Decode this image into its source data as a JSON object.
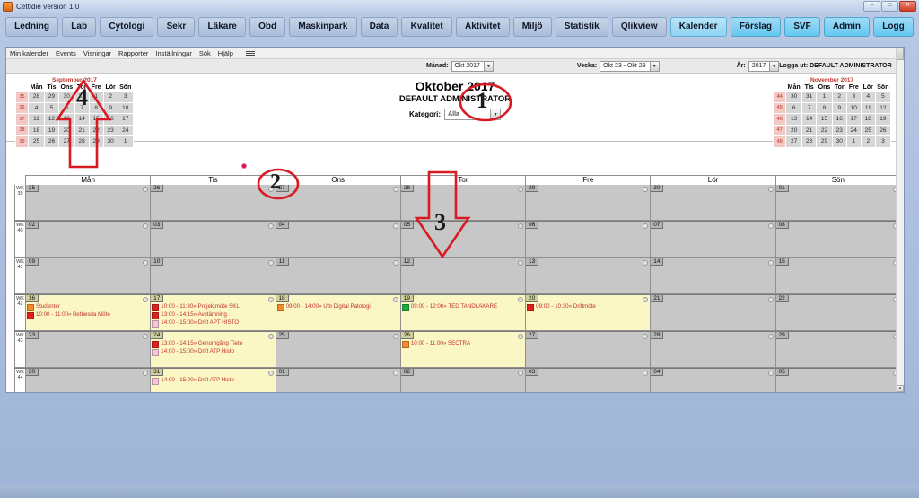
{
  "window": {
    "title": "Cettidie version 1.0",
    "min_label": "–",
    "max_label": "□",
    "close_label": "✕"
  },
  "nav": {
    "buttons": [
      {
        "label": "Ledning",
        "state": "normal"
      },
      {
        "label": "Lab",
        "state": "normal"
      },
      {
        "label": "Cytologi",
        "state": "normal"
      },
      {
        "label": "Sekr",
        "state": "normal"
      },
      {
        "label": "Läkare",
        "state": "normal"
      },
      {
        "label": "Obd",
        "state": "normal"
      },
      {
        "label": "Maskinpark",
        "state": "normal"
      },
      {
        "label": "Data",
        "state": "normal"
      },
      {
        "label": "Kvalitet",
        "state": "normal"
      },
      {
        "label": "Aktivitet",
        "state": "normal"
      },
      {
        "label": "Miljö",
        "state": "normal"
      },
      {
        "label": "Statistik",
        "state": "normal"
      },
      {
        "label": "Qlikview",
        "state": "normal"
      },
      {
        "label": "Kalender",
        "state": "selected"
      },
      {
        "label": "Förslag",
        "state": "highlight"
      },
      {
        "label": "SVF",
        "state": "highlight"
      },
      {
        "label": "Admin",
        "state": "highlight"
      },
      {
        "label": "Logg",
        "state": "highlight"
      }
    ]
  },
  "menu": {
    "items": [
      "Min kalender",
      "Events",
      "Visningar",
      "Rapporter",
      "Inställningar",
      "Sök",
      "Hjälp"
    ],
    "grip_icon": "menu-grip-icon"
  },
  "toolbar": {
    "month": {
      "label": "Månad:",
      "value": "Okt 2017",
      "arrow": "▼"
    },
    "week": {
      "label": "Vecka:",
      "value": "Okt 23 - Okt 29",
      "arrow": "▼"
    },
    "year": {
      "label": "År:",
      "value": "2017",
      "arrow": "▼"
    },
    "logout": "Logga ut: DEFAULT ADMINISTRATOR"
  },
  "header": {
    "month_title": "Oktober 2017",
    "user": "DEFAULT ADMINISTRATOR",
    "category_label": "Kategori:",
    "category_value": "Alla",
    "category_arrow": "▼"
  },
  "mini_prev": {
    "caption": "September 2017",
    "weekday_headers": [
      "Mån",
      "Tis",
      "Ons",
      "Tor",
      "Fre",
      "Lör",
      "Sön"
    ],
    "rows": [
      {
        "wk": "35",
        "days": [
          "28",
          "29",
          "30",
          "31",
          "1",
          "2",
          "3"
        ]
      },
      {
        "wk": "36",
        "days": [
          "4",
          "5",
          "6",
          "7",
          "8",
          "9",
          "10"
        ]
      },
      {
        "wk": "37",
        "days": [
          "11",
          "12",
          "13",
          "14",
          "15",
          "16",
          "17"
        ]
      },
      {
        "wk": "38",
        "days": [
          "18",
          "19",
          "20",
          "21",
          "22",
          "23",
          "24"
        ]
      },
      {
        "wk": "39",
        "days": [
          "25",
          "26",
          "27",
          "28",
          "29",
          "30",
          "1"
        ]
      }
    ]
  },
  "mini_next": {
    "caption": "November 2017",
    "weekday_headers": [
      "Mån",
      "Tis",
      "Ons",
      "Tor",
      "Fre",
      "Lör",
      "Sön"
    ],
    "rows": [
      {
        "wk": "44",
        "days": [
          "30",
          "31",
          "1",
          "2",
          "3",
          "4",
          "5"
        ]
      },
      {
        "wk": "45",
        "days": [
          "6",
          "7",
          "8",
          "9",
          "10",
          "11",
          "12"
        ]
      },
      {
        "wk": "46",
        "days": [
          "13",
          "14",
          "15",
          "16",
          "17",
          "18",
          "19"
        ]
      },
      {
        "wk": "47",
        "days": [
          "20",
          "21",
          "22",
          "23",
          "24",
          "25",
          "26"
        ]
      },
      {
        "wk": "48",
        "days": [
          "27",
          "28",
          "29",
          "30",
          "1",
          "2",
          "3"
        ]
      }
    ]
  },
  "calendar": {
    "day_headers": [
      "Mån",
      "Tis",
      "Ons",
      "Tor",
      "Fre",
      "Lör",
      "Sön"
    ],
    "weeks": [
      {
        "wk": "WK39",
        "days": [
          {
            "num": "25",
            "events": []
          },
          {
            "num": "26",
            "events": []
          },
          {
            "num": "27",
            "events": []
          },
          {
            "num": "28",
            "events": []
          },
          {
            "num": "29",
            "events": []
          },
          {
            "num": "30",
            "events": []
          },
          {
            "num": "01",
            "events": []
          }
        ]
      },
      {
        "wk": "WK40",
        "days": [
          {
            "num": "02",
            "events": []
          },
          {
            "num": "03",
            "events": []
          },
          {
            "num": "04",
            "events": []
          },
          {
            "num": "05",
            "events": []
          },
          {
            "num": "06",
            "events": []
          },
          {
            "num": "07",
            "events": []
          },
          {
            "num": "08",
            "events": []
          }
        ]
      },
      {
        "wk": "WK41",
        "days": [
          {
            "num": "09",
            "events": []
          },
          {
            "num": "10",
            "events": []
          },
          {
            "num": "11",
            "events": []
          },
          {
            "num": "12",
            "events": []
          },
          {
            "num": "13",
            "events": []
          },
          {
            "num": "14",
            "events": []
          },
          {
            "num": "15",
            "events": []
          }
        ]
      },
      {
        "wk": "WK42",
        "days": [
          {
            "num": "16",
            "events": [
              {
                "color": "#f28a2e",
                "text": "Studenter"
              },
              {
                "color": "#e02020",
                "text": "10:00 - 11:00» Bethesda Möte"
              }
            ]
          },
          {
            "num": "17",
            "events": [
              {
                "color": "#e02020",
                "text": "10:00 - 11:30» Projektmöte SKL"
              },
              {
                "color": "#e02020",
                "text": "13:00 - 14:15» Avstämning"
              },
              {
                "color": "#f7c6d6",
                "text": "14:00 - 15:00» Drift APT HISTO"
              }
            ]
          },
          {
            "num": "18",
            "events": [
              {
                "color": "#f28a2e",
                "text": "09:00 - 14:00» Utb Digital Patologi"
              }
            ]
          },
          {
            "num": "19",
            "events": [
              {
                "color": "#1faa3c",
                "text": "09:00 - 12:00» TED TANDLÄKARE"
              }
            ]
          },
          {
            "num": "20",
            "events": [
              {
                "color": "#e02020",
                "text": "09:00 - 10:30» Driftmöte"
              }
            ]
          },
          {
            "num": "21",
            "events": []
          },
          {
            "num": "22",
            "events": []
          }
        ]
      },
      {
        "wk": "WK43",
        "days": [
          {
            "num": "23",
            "events": []
          },
          {
            "num": "24",
            "events": [
              {
                "color": "#e02020",
                "text": "13:00 - 14:15» Genomgång Tieto"
              },
              {
                "color": "#f7c6d6",
                "text": "14:00 - 15:00» Drift ATP Histo"
              }
            ]
          },
          {
            "num": "25",
            "events": []
          },
          {
            "num": "26",
            "events": [
              {
                "color": "#f28a2e",
                "text": "10:00 - 11:00» SECTRA"
              }
            ]
          },
          {
            "num": "27",
            "events": []
          },
          {
            "num": "28",
            "events": []
          },
          {
            "num": "29",
            "events": []
          }
        ]
      },
      {
        "wk": "WK44",
        "days": [
          {
            "num": "30",
            "events": []
          },
          {
            "num": "31",
            "events": [
              {
                "color": "#f7c6d6",
                "text": "14:00 - 15:00» Drift ATP Histo"
              }
            ]
          },
          {
            "num": "01",
            "events": []
          },
          {
            "num": "02",
            "events": []
          },
          {
            "num": "03",
            "events": []
          },
          {
            "num": "04",
            "events": []
          },
          {
            "num": "05",
            "events": []
          }
        ]
      }
    ]
  },
  "annotations": {
    "accent_color": "#d81b23",
    "markers": [
      {
        "label": "1",
        "shape": "circle",
        "target": "category-dropdown"
      },
      {
        "label": "2",
        "shape": "circle",
        "target": "calendar-cell-ons-week40"
      },
      {
        "label": "3",
        "shape": "arrow-down",
        "target": "calendar-cell-tor-week42"
      },
      {
        "label": "4",
        "shape": "arrow-down",
        "target": "calendar-cell-man-week39"
      }
    ]
  }
}
